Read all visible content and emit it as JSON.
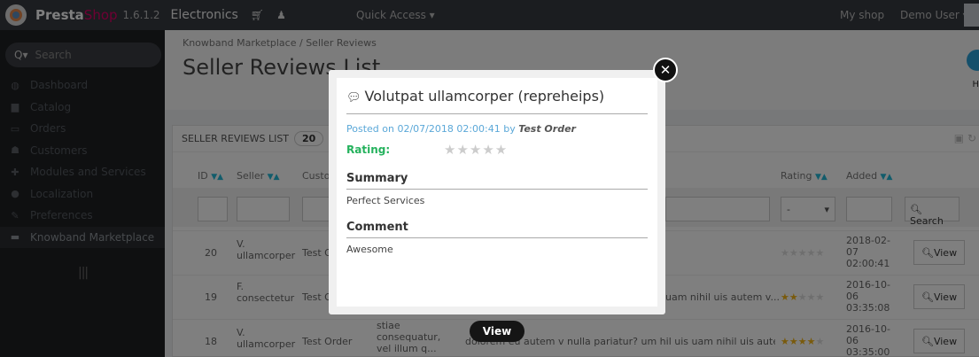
{
  "topbar": {
    "brand_a": "Presta",
    "brand_b": "Shop",
    "version": "1.6.1.2",
    "shop": "Electronics",
    "quick_access": "Quick Access ▾",
    "my_shop": "My shop",
    "user": "Demo User ▾",
    "icons": [
      "cart-icon",
      "user-icon"
    ]
  },
  "sidebar": {
    "search_placeholder": "Search",
    "items": [
      {
        "label": "Dashboard",
        "icon": "dashboard-icon"
      },
      {
        "label": "Catalog",
        "icon": "catalog-icon"
      },
      {
        "label": "Orders",
        "icon": "orders-icon"
      },
      {
        "label": "Customers",
        "icon": "customers-icon"
      },
      {
        "label": "Modules and Services",
        "icon": "modules-icon"
      },
      {
        "label": "Localization",
        "icon": "globe-icon"
      },
      {
        "label": "Preferences",
        "icon": "wrench-icon"
      },
      {
        "label": "Knowband Marketplace",
        "icon": "marketplace-icon"
      }
    ]
  },
  "header": {
    "breadcrumb": "Knowband Marketplace  /  Seller Reviews",
    "title": "Seller Reviews List",
    "help": "H"
  },
  "panel": {
    "title": "SELLER REVIEWS LIST",
    "count": "20",
    "columns": [
      "ID",
      "Seller",
      "Custo",
      "Rating",
      "Added"
    ],
    "filter_select": "-",
    "search_label": "Search",
    "rows": [
      {
        "id": "20",
        "seller": "V. ullamcorper",
        "customer": "Test O",
        "content": "",
        "stars": 0,
        "added": "2018-02-07 02:00:41"
      },
      {
        "id": "19",
        "seller": "F. consectetur",
        "customer": "Test O",
        "content": "uam nihil uis autem v...",
        "stars": 2,
        "added": "2016-10-06 03:35:08"
      },
      {
        "id": "18",
        "seller": "V. ullamcorper",
        "customer": "Test Order",
        "title_snip": "stiae consequatur, vel illum q...",
        "content": "dolorem eu autem v nulla pariatur? um hil uis uam nihil uis autem v...",
        "stars": 4,
        "added": "2016-10-06 03:35:00"
      }
    ],
    "view_label": "View"
  },
  "modal": {
    "title": "Volutpat ullamcorper (repreheips)",
    "posted_prefix": "Posted on 02/07/2018 02:00:41 by",
    "posted_by": "Test Order",
    "rating_label": "Rating:",
    "rating_value": 0,
    "summary_heading": "Summary",
    "summary_text": "Perfect Services",
    "comment_heading": "Comment",
    "comment_text": "Awesome",
    "close_symbol": "✕"
  },
  "tooltip": {
    "label": "View"
  }
}
